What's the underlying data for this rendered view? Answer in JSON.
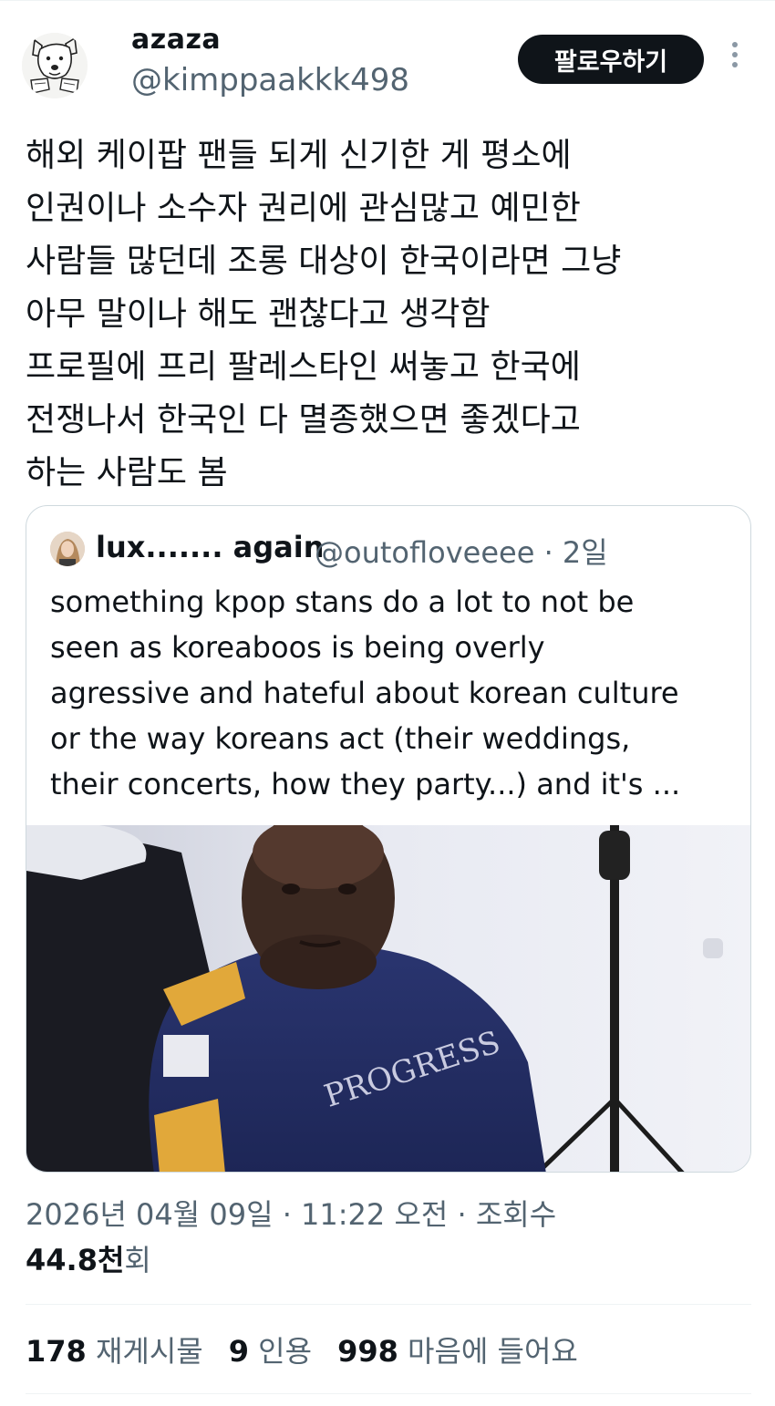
{
  "author": {
    "display_name": "azaza",
    "handle": "@kimppaakkk498",
    "avatar_icon": "dog-sketch-avatar"
  },
  "follow_button_label": "팔로우하기",
  "more_icon": "more-options-icon",
  "tweet_lines": [
    "해외 케이팝 팬들 되게 신기한 게 평소에",
    "인권이나 소수자 권리에 관심많고 예민한",
    "사람들 많던데 조롱 대상이 한국이라면 그냥",
    "아무 말이나 해도 괜찮다고 생각함",
    "프로필에 프리 팔레스타인 써놓고 한국에",
    "전쟁나서 한국인 다 멸종했으면 좋겠다고",
    "하는 사람도 봄"
  ],
  "quote": {
    "name": "lux....... again",
    "handle_time": "@outofloveeee · 2일",
    "lines": [
      "something kpop stans do a lot to not be",
      "seen as koreaboos is being overly",
      "agressive and hateful about korean culture",
      "or the way koreans act (their weddings,",
      "their concerts, how they party...) and it's ..."
    ],
    "shirt_print": "PROGRESS"
  },
  "meta": {
    "timestamp": "2026년 04월 09일 · 11:22 오전 · 조회수",
    "views_num": "44.8천",
    "views_label": "회"
  },
  "stats": [
    {
      "num": "178",
      "label": "재게시물"
    },
    {
      "num": "9",
      "label": "인용"
    },
    {
      "num": "998",
      "label": "마음에 들어요"
    }
  ],
  "colors": {
    "text": "#0f1419",
    "secondary": "#536471",
    "border": "#cfd9de",
    "button_bg": "#0f1419"
  }
}
